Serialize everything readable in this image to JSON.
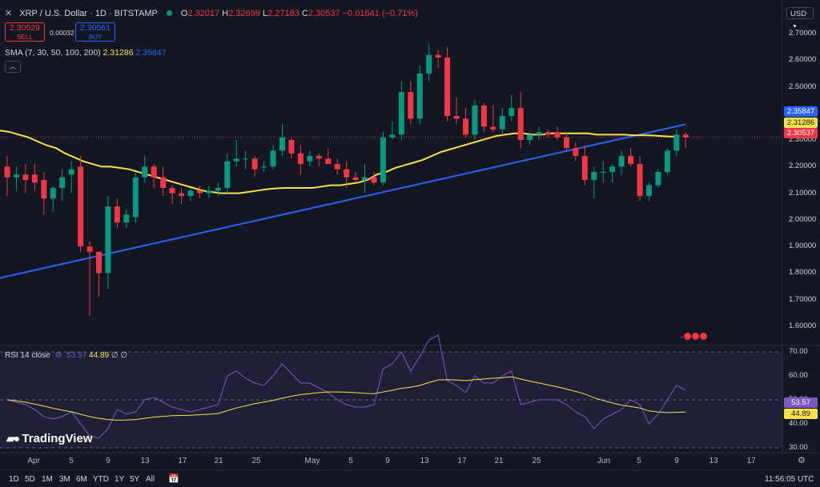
{
  "header": {
    "symbol": "XRP / U.S. Dollar · 1D · BITSTAMP",
    "o_key": "O",
    "o": "2.32017",
    "h_key": "H",
    "h": "2.32699",
    "l_key": "L",
    "l": "2.27183",
    "c_key": "C",
    "c": "2.30537",
    "change": "−0.01641 (−0.71%)"
  },
  "trade": {
    "sell_price": "2.30529",
    "sell_label": "SELL",
    "spread": "0.00032",
    "buy_price": "2.30561",
    "buy_label": "BUY"
  },
  "sma": {
    "label": "SMA (7, 30, 50, 100, 200)",
    "v1": "2.31286",
    "v2": "2.35847",
    "color1": "#f7e14d",
    "color2": "#2962ff"
  },
  "currency": "USD",
  "price_axis": [
    "2.70000",
    "2.60000",
    "2.50000",
    "2.40000",
    "2.30000",
    "2.20000",
    "2.10000",
    "2.00000",
    "1.90000",
    "1.80000",
    "1.70000",
    "1.60000"
  ],
  "badges": [
    {
      "text": "2.35847",
      "color": "#2962ff"
    },
    {
      "text": "2.31286",
      "color": "#f7e14d"
    },
    {
      "text": "2.30537",
      "color": "#f23645"
    }
  ],
  "rsi": {
    "label": "RSI 14 close",
    "v1": "53.57",
    "v2": "44.89",
    "extra": "∅ ∅",
    "axis": [
      "70.00",
      "60.00",
      "50.00",
      "40.00",
      "30.00"
    ]
  },
  "x_axis": [
    "Apr",
    "5",
    "9",
    "13",
    "17",
    "21",
    "25",
    "May",
    "5",
    "9",
    "13",
    "17",
    "21",
    "25",
    "Jun",
    "5",
    "9",
    "13",
    "17"
  ],
  "timeframes": [
    "1D",
    "5D",
    "1M",
    "3M",
    "6M",
    "YTD",
    "1Y",
    "5Y",
    "All"
  ],
  "clock": "11:56:05 UTC",
  "logo": "TradingView",
  "colors": {
    "up": "#089981",
    "down": "#f23645",
    "bg": "#131722",
    "rsi_line": "#7e57c2",
    "rsi_ma": "#f7e14d"
  },
  "chart_data": {
    "type": "candlestick",
    "candles": [
      {
        "o": 2.2,
        "h": 2.24,
        "l": 2.09,
        "c": 2.16
      },
      {
        "o": 2.16,
        "h": 2.2,
        "l": 2.11,
        "c": 2.17
      },
      {
        "o": 2.17,
        "h": 2.21,
        "l": 2.1,
        "c": 2.15
      },
      {
        "o": 2.17,
        "h": 2.21,
        "l": 2.11,
        "c": 2.14
      },
      {
        "o": 2.15,
        "h": 2.18,
        "l": 2.02,
        "c": 2.08
      },
      {
        "o": 2.08,
        "h": 2.13,
        "l": 2.03,
        "c": 2.12
      },
      {
        "o": 2.12,
        "h": 2.19,
        "l": 2.07,
        "c": 2.16
      },
      {
        "o": 2.17,
        "h": 2.22,
        "l": 2.1,
        "c": 2.19
      },
      {
        "o": 2.2,
        "h": 2.24,
        "l": 1.88,
        "c": 1.9
      },
      {
        "o": 1.9,
        "h": 1.92,
        "l": 1.64,
        "c": 1.88
      },
      {
        "o": 1.88,
        "h": 1.88,
        "l": 1.71,
        "c": 1.8
      },
      {
        "o": 1.8,
        "h": 2.09,
        "l": 1.74,
        "c": 2.05
      },
      {
        "o": 2.05,
        "h": 2.08,
        "l": 1.97,
        "c": 1.99
      },
      {
        "o": 1.99,
        "h": 2.04,
        "l": 1.97,
        "c": 2.02
      },
      {
        "o": 2.01,
        "h": 2.18,
        "l": 1.99,
        "c": 2.16
      },
      {
        "o": 2.16,
        "h": 2.24,
        "l": 2.14,
        "c": 2.2
      },
      {
        "o": 2.2,
        "h": 2.21,
        "l": 2.12,
        "c": 2.16
      },
      {
        "o": 2.16,
        "h": 2.2,
        "l": 2.09,
        "c": 2.12
      },
      {
        "o": 2.12,
        "h": 2.13,
        "l": 2.06,
        "c": 2.1
      },
      {
        "o": 2.1,
        "h": 2.12,
        "l": 2.06,
        "c": 2.09
      },
      {
        "o": 2.09,
        "h": 2.12,
        "l": 2.07,
        "c": 2.11
      },
      {
        "o": 2.11,
        "h": 2.13,
        "l": 2.08,
        "c": 2.1
      },
      {
        "o": 2.1,
        "h": 2.13,
        "l": 2.08,
        "c": 2.11
      },
      {
        "o": 2.11,
        "h": 2.14,
        "l": 2.09,
        "c": 2.12
      },
      {
        "o": 2.12,
        "h": 2.25,
        "l": 2.1,
        "c": 2.22
      },
      {
        "o": 2.22,
        "h": 2.3,
        "l": 2.2,
        "c": 2.23
      },
      {
        "o": 2.23,
        "h": 2.26,
        "l": 2.19,
        "c": 2.23
      },
      {
        "o": 2.23,
        "h": 2.24,
        "l": 2.16,
        "c": 2.19
      },
      {
        "o": 2.2,
        "h": 2.22,
        "l": 2.18,
        "c": 2.2
      },
      {
        "o": 2.2,
        "h": 2.28,
        "l": 2.19,
        "c": 2.26
      },
      {
        "o": 2.26,
        "h": 2.36,
        "l": 2.24,
        "c": 2.31
      },
      {
        "o": 2.3,
        "h": 2.31,
        "l": 2.23,
        "c": 2.25
      },
      {
        "o": 2.25,
        "h": 2.28,
        "l": 2.17,
        "c": 2.21
      },
      {
        "o": 2.22,
        "h": 2.26,
        "l": 2.2,
        "c": 2.24
      },
      {
        "o": 2.24,
        "h": 2.25,
        "l": 2.2,
        "c": 2.23
      },
      {
        "o": 2.23,
        "h": 2.27,
        "l": 2.21,
        "c": 2.21
      },
      {
        "o": 2.21,
        "h": 2.23,
        "l": 2.17,
        "c": 2.19
      },
      {
        "o": 2.19,
        "h": 2.22,
        "l": 2.12,
        "c": 2.16
      },
      {
        "o": 2.16,
        "h": 2.18,
        "l": 2.14,
        "c": 2.15
      },
      {
        "o": 2.15,
        "h": 2.21,
        "l": 2.1,
        "c": 2.16
      },
      {
        "o": 2.16,
        "h": 2.18,
        "l": 2.13,
        "c": 2.14
      },
      {
        "o": 2.14,
        "h": 2.33,
        "l": 2.13,
        "c": 2.31
      },
      {
        "o": 2.31,
        "h": 2.37,
        "l": 2.3,
        "c": 2.32
      },
      {
        "o": 2.32,
        "h": 2.52,
        "l": 2.3,
        "c": 2.48
      },
      {
        "o": 2.48,
        "h": 2.52,
        "l": 2.36,
        "c": 2.38
      },
      {
        "o": 2.38,
        "h": 2.58,
        "l": 2.36,
        "c": 2.55
      },
      {
        "o": 2.55,
        "h": 2.66,
        "l": 2.52,
        "c": 2.62
      },
      {
        "o": 2.62,
        "h": 2.64,
        "l": 2.57,
        "c": 2.61
      },
      {
        "o": 2.61,
        "h": 2.65,
        "l": 2.37,
        "c": 2.39
      },
      {
        "o": 2.39,
        "h": 2.46,
        "l": 2.36,
        "c": 2.38
      },
      {
        "o": 2.38,
        "h": 2.42,
        "l": 2.31,
        "c": 2.32
      },
      {
        "o": 2.32,
        "h": 2.45,
        "l": 2.3,
        "c": 2.43
      },
      {
        "o": 2.43,
        "h": 2.44,
        "l": 2.33,
        "c": 2.35
      },
      {
        "o": 2.35,
        "h": 2.43,
        "l": 2.33,
        "c": 2.34
      },
      {
        "o": 2.34,
        "h": 2.42,
        "l": 2.32,
        "c": 2.39
      },
      {
        "o": 2.39,
        "h": 2.47,
        "l": 2.37,
        "c": 2.42
      },
      {
        "o": 2.42,
        "h": 2.48,
        "l": 2.27,
        "c": 2.3
      },
      {
        "o": 2.3,
        "h": 2.33,
        "l": 2.28,
        "c": 2.32
      },
      {
        "o": 2.32,
        "h": 2.35,
        "l": 2.3,
        "c": 2.33
      },
      {
        "o": 2.33,
        "h": 2.34,
        "l": 2.31,
        "c": 2.32
      },
      {
        "o": 2.33,
        "h": 2.35,
        "l": 2.3,
        "c": 2.31
      },
      {
        "o": 2.31,
        "h": 2.33,
        "l": 2.26,
        "c": 2.27
      },
      {
        "o": 2.27,
        "h": 2.29,
        "l": 2.22,
        "c": 2.24
      },
      {
        "o": 2.24,
        "h": 2.28,
        "l": 2.13,
        "c": 2.15
      },
      {
        "o": 2.15,
        "h": 2.2,
        "l": 2.08,
        "c": 2.18
      },
      {
        "o": 2.18,
        "h": 2.22,
        "l": 2.14,
        "c": 2.18
      },
      {
        "o": 2.18,
        "h": 2.21,
        "l": 2.14,
        "c": 2.2
      },
      {
        "o": 2.2,
        "h": 2.26,
        "l": 2.17,
        "c": 2.24
      },
      {
        "o": 2.24,
        "h": 2.27,
        "l": 2.2,
        "c": 2.21
      },
      {
        "o": 2.21,
        "h": 2.24,
        "l": 2.07,
        "c": 2.09
      },
      {
        "o": 2.09,
        "h": 2.14,
        "l": 2.07,
        "c": 2.13
      },
      {
        "o": 2.13,
        "h": 2.19,
        "l": 2.12,
        "c": 2.18
      },
      {
        "o": 2.18,
        "h": 2.27,
        "l": 2.17,
        "c": 2.26
      },
      {
        "o": 2.26,
        "h": 2.34,
        "l": 2.24,
        "c": 2.32
      },
      {
        "o": 2.32,
        "h": 2.33,
        "l": 2.27,
        "c": 2.31
      }
    ],
    "sma_slow": [
      2.335,
      2.33,
      2.32,
      2.31,
      2.295,
      2.28,
      2.27,
      2.25,
      2.235,
      2.22,
      2.21,
      2.2,
      2.2,
      2.195,
      2.19,
      2.18,
      2.17,
      2.16,
      2.15,
      2.14,
      2.13,
      2.12,
      2.11,
      2.105,
      2.1,
      2.1,
      2.1,
      2.105,
      2.11,
      2.115,
      2.118,
      2.12,
      2.12,
      2.12,
      2.12,
      2.125,
      2.13,
      2.13,
      2.135,
      2.14,
      2.15,
      2.17,
      2.18,
      2.195,
      2.205,
      2.215,
      2.225,
      2.24,
      2.255,
      2.265,
      2.275,
      2.285,
      2.295,
      2.305,
      2.315,
      2.32,
      2.325,
      2.325,
      2.32,
      2.32,
      2.325,
      2.325,
      2.325,
      2.325,
      2.325,
      2.32,
      2.32,
      2.32,
      2.32,
      2.318,
      2.318,
      2.317,
      2.315,
      2.313,
      2.313
    ],
    "sma_fast_start": 1.78,
    "sma_fast_end": 2.359,
    "rsi_line": [
      50,
      49,
      48,
      46,
      43,
      42,
      43,
      45,
      40,
      35,
      34,
      38,
      46,
      44,
      45,
      50,
      51,
      49,
      47,
      46,
      45,
      46,
      47,
      48,
      60,
      62,
      59,
      57,
      56,
      60,
      65,
      61,
      57,
      57,
      55,
      53,
      50,
      48,
      47,
      47,
      48,
      63,
      65,
      70,
      62,
      68,
      75,
      77,
      58,
      56,
      53,
      60,
      57,
      57,
      60,
      62,
      48,
      49,
      50,
      50,
      50,
      48,
      45,
      43,
      38,
      42,
      44,
      46,
      50,
      48,
      40,
      44,
      50,
      56,
      54
    ],
    "rsi_ma": [
      50,
      49.6,
      49,
      48.2,
      47.4,
      46.5,
      45.7,
      45,
      44,
      43,
      42.3,
      41.8,
      41.5,
      41.6,
      41.8,
      42.3,
      42.8,
      43.1,
      43.4,
      43.5,
      43.6,
      43.8,
      44,
      44.3,
      45.5,
      46.6,
      47.5,
      48.4,
      49.1,
      49.8,
      50.7,
      51.5,
      52.2,
      52.6,
      53,
      53.3,
      53.3,
      53.2,
      53,
      52.7,
      52.6,
      53.3,
      54,
      54.8,
      55.3,
      56,
      57.2,
      58.3,
      58.4,
      58.3,
      58,
      58.4,
      58.7,
      59,
      59.2,
      59.6,
      58.7,
      57.8,
      57,
      56.2,
      55.4,
      54.5,
      53.5,
      52.4,
      50.9,
      49.7,
      48.7,
      47.8,
      47.2,
      46.6,
      45.4,
      44.9,
      44.7,
      44.8,
      44.9
    ],
    "y_range": [
      1.54,
      2.76
    ],
    "rsi_range": [
      28,
      72
    ],
    "x_labels": [
      "Apr",
      "5",
      "9",
      "13",
      "17",
      "21",
      "25",
      "May",
      "5",
      "9",
      "13",
      "17",
      "21",
      "25",
      "Jun",
      "5",
      "9",
      "13",
      "17"
    ]
  }
}
